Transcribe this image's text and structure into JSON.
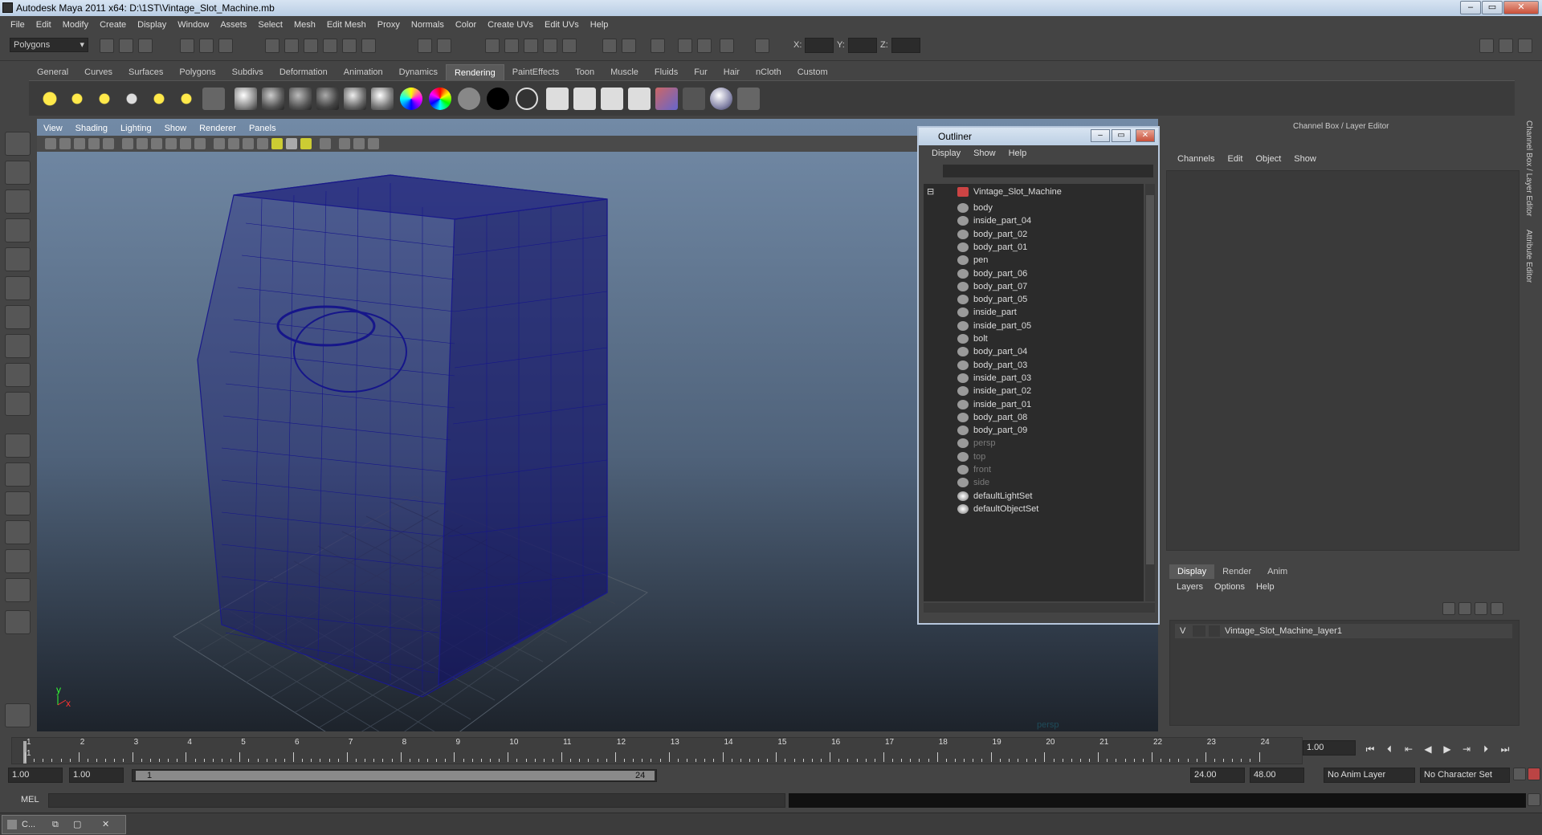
{
  "window": {
    "title": "Autodesk Maya 2011 x64: D:\\1ST\\Vintage_Slot_Machine.mb"
  },
  "menubar": [
    "File",
    "Edit",
    "Modify",
    "Create",
    "Display",
    "Window",
    "Assets",
    "Select",
    "Mesh",
    "Edit Mesh",
    "Proxy",
    "Normals",
    "Color",
    "Create UVs",
    "Edit UVs",
    "Help"
  ],
  "statusline": {
    "mode": "Polygons",
    "x_label": "X:",
    "y_label": "Y:",
    "z_label": "Z:"
  },
  "shelf_tabs": [
    "General",
    "Curves",
    "Surfaces",
    "Polygons",
    "Subdivs",
    "Deformation",
    "Animation",
    "Dynamics",
    "Rendering",
    "PaintEffects",
    "Toon",
    "Muscle",
    "Fluids",
    "Fur",
    "Hair",
    "nCloth",
    "Custom"
  ],
  "shelf_active": "Rendering",
  "viewport": {
    "menu": [
      "View",
      "Shading",
      "Lighting",
      "Show",
      "Renderer",
      "Panels"
    ],
    "camera_label": "persp",
    "axis_y": "y",
    "axis_x": "x"
  },
  "outliner": {
    "title": "Outliner",
    "menu": [
      "Display",
      "Show",
      "Help"
    ],
    "root": "Vintage_Slot_Machine",
    "children": [
      "body",
      "inside_part_04",
      "body_part_02",
      "body_part_01",
      "pen",
      "body_part_06",
      "body_part_07",
      "body_part_05",
      "inside_part",
      "inside_part_05",
      "bolt",
      "body_part_04",
      "body_part_03",
      "inside_part_03",
      "inside_part_02",
      "inside_part_01",
      "body_part_08",
      "body_part_09"
    ],
    "cameras": [
      "persp",
      "top",
      "front",
      "side"
    ],
    "sets": [
      "defaultLightSet",
      "defaultObjectSet"
    ]
  },
  "channel_box": {
    "title": "Channel Box / Layer Editor",
    "menu": [
      "Channels",
      "Edit",
      "Object",
      "Show"
    ],
    "layer_tabs": [
      "Display",
      "Render",
      "Anim"
    ],
    "layer_tab_active": "Display",
    "layer_menu": [
      "Layers",
      "Options",
      "Help"
    ],
    "layer": {
      "visible": "V",
      "name": "Vintage_Slot_Machine_layer1"
    }
  },
  "side_tabs": [
    "Channel Box / Layer Editor",
    "Attribute Editor"
  ],
  "time_slider": {
    "ticks": [
      "1",
      "2",
      "3",
      "4",
      "5",
      "6",
      "7",
      "8",
      "9",
      "10",
      "11",
      "12",
      "13",
      "14",
      "15",
      "16",
      "17",
      "18",
      "19",
      "20",
      "21",
      "22",
      "23",
      "24"
    ],
    "current_frame": "1",
    "current_time": "1.00"
  },
  "range_slider": {
    "start": "1.00",
    "playback_start": "1.00",
    "range_min": "1",
    "range_max": "24",
    "playback_end": "24.00",
    "end": "48.00",
    "anim_layer": "No Anim Layer",
    "character_set": "No Character Set"
  },
  "command_line": {
    "label": "MEL"
  },
  "taskbar": {
    "item": "C..."
  }
}
